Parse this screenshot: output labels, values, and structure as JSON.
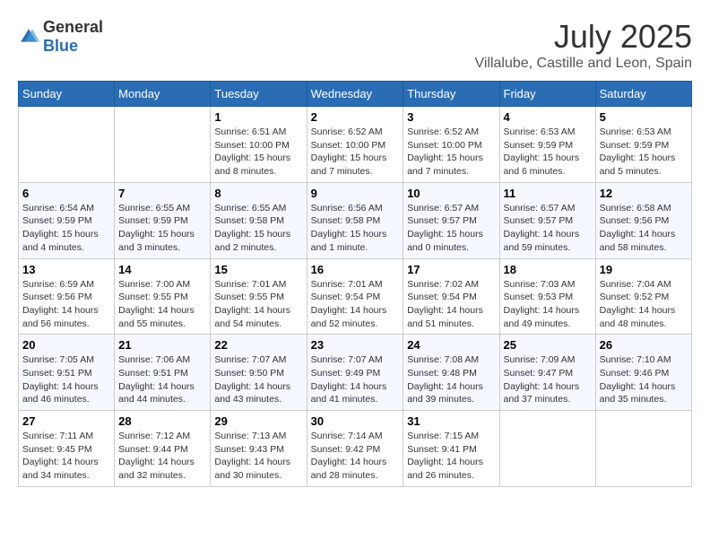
{
  "logo": {
    "general": "General",
    "blue": "Blue"
  },
  "title": "July 2025",
  "subtitle": "Villalube, Castille and Leon, Spain",
  "weekdays": [
    "Sunday",
    "Monday",
    "Tuesday",
    "Wednesday",
    "Thursday",
    "Friday",
    "Saturday"
  ],
  "weeks": [
    [
      {
        "num": "",
        "sunrise": "",
        "sunset": "",
        "daylight": ""
      },
      {
        "num": "",
        "sunrise": "",
        "sunset": "",
        "daylight": ""
      },
      {
        "num": "1",
        "sunrise": "Sunrise: 6:51 AM",
        "sunset": "Sunset: 10:00 PM",
        "daylight": "Daylight: 15 hours and 8 minutes."
      },
      {
        "num": "2",
        "sunrise": "Sunrise: 6:52 AM",
        "sunset": "Sunset: 10:00 PM",
        "daylight": "Daylight: 15 hours and 7 minutes."
      },
      {
        "num": "3",
        "sunrise": "Sunrise: 6:52 AM",
        "sunset": "Sunset: 10:00 PM",
        "daylight": "Daylight: 15 hours and 7 minutes."
      },
      {
        "num": "4",
        "sunrise": "Sunrise: 6:53 AM",
        "sunset": "Sunset: 9:59 PM",
        "daylight": "Daylight: 15 hours and 6 minutes."
      },
      {
        "num": "5",
        "sunrise": "Sunrise: 6:53 AM",
        "sunset": "Sunset: 9:59 PM",
        "daylight": "Daylight: 15 hours and 5 minutes."
      }
    ],
    [
      {
        "num": "6",
        "sunrise": "Sunrise: 6:54 AM",
        "sunset": "Sunset: 9:59 PM",
        "daylight": "Daylight: 15 hours and 4 minutes."
      },
      {
        "num": "7",
        "sunrise": "Sunrise: 6:55 AM",
        "sunset": "Sunset: 9:59 PM",
        "daylight": "Daylight: 15 hours and 3 minutes."
      },
      {
        "num": "8",
        "sunrise": "Sunrise: 6:55 AM",
        "sunset": "Sunset: 9:58 PM",
        "daylight": "Daylight: 15 hours and 2 minutes."
      },
      {
        "num": "9",
        "sunrise": "Sunrise: 6:56 AM",
        "sunset": "Sunset: 9:58 PM",
        "daylight": "Daylight: 15 hours and 1 minute."
      },
      {
        "num": "10",
        "sunrise": "Sunrise: 6:57 AM",
        "sunset": "Sunset: 9:57 PM",
        "daylight": "Daylight: 15 hours and 0 minutes."
      },
      {
        "num": "11",
        "sunrise": "Sunrise: 6:57 AM",
        "sunset": "Sunset: 9:57 PM",
        "daylight": "Daylight: 14 hours and 59 minutes."
      },
      {
        "num": "12",
        "sunrise": "Sunrise: 6:58 AM",
        "sunset": "Sunset: 9:56 PM",
        "daylight": "Daylight: 14 hours and 58 minutes."
      }
    ],
    [
      {
        "num": "13",
        "sunrise": "Sunrise: 6:59 AM",
        "sunset": "Sunset: 9:56 PM",
        "daylight": "Daylight: 14 hours and 56 minutes."
      },
      {
        "num": "14",
        "sunrise": "Sunrise: 7:00 AM",
        "sunset": "Sunset: 9:55 PM",
        "daylight": "Daylight: 14 hours and 55 minutes."
      },
      {
        "num": "15",
        "sunrise": "Sunrise: 7:01 AM",
        "sunset": "Sunset: 9:55 PM",
        "daylight": "Daylight: 14 hours and 54 minutes."
      },
      {
        "num": "16",
        "sunrise": "Sunrise: 7:01 AM",
        "sunset": "Sunset: 9:54 PM",
        "daylight": "Daylight: 14 hours and 52 minutes."
      },
      {
        "num": "17",
        "sunrise": "Sunrise: 7:02 AM",
        "sunset": "Sunset: 9:54 PM",
        "daylight": "Daylight: 14 hours and 51 minutes."
      },
      {
        "num": "18",
        "sunrise": "Sunrise: 7:03 AM",
        "sunset": "Sunset: 9:53 PM",
        "daylight": "Daylight: 14 hours and 49 minutes."
      },
      {
        "num": "19",
        "sunrise": "Sunrise: 7:04 AM",
        "sunset": "Sunset: 9:52 PM",
        "daylight": "Daylight: 14 hours and 48 minutes."
      }
    ],
    [
      {
        "num": "20",
        "sunrise": "Sunrise: 7:05 AM",
        "sunset": "Sunset: 9:51 PM",
        "daylight": "Daylight: 14 hours and 46 minutes."
      },
      {
        "num": "21",
        "sunrise": "Sunrise: 7:06 AM",
        "sunset": "Sunset: 9:51 PM",
        "daylight": "Daylight: 14 hours and 44 minutes."
      },
      {
        "num": "22",
        "sunrise": "Sunrise: 7:07 AM",
        "sunset": "Sunset: 9:50 PM",
        "daylight": "Daylight: 14 hours and 43 minutes."
      },
      {
        "num": "23",
        "sunrise": "Sunrise: 7:07 AM",
        "sunset": "Sunset: 9:49 PM",
        "daylight": "Daylight: 14 hours and 41 minutes."
      },
      {
        "num": "24",
        "sunrise": "Sunrise: 7:08 AM",
        "sunset": "Sunset: 9:48 PM",
        "daylight": "Daylight: 14 hours and 39 minutes."
      },
      {
        "num": "25",
        "sunrise": "Sunrise: 7:09 AM",
        "sunset": "Sunset: 9:47 PM",
        "daylight": "Daylight: 14 hours and 37 minutes."
      },
      {
        "num": "26",
        "sunrise": "Sunrise: 7:10 AM",
        "sunset": "Sunset: 9:46 PM",
        "daylight": "Daylight: 14 hours and 35 minutes."
      }
    ],
    [
      {
        "num": "27",
        "sunrise": "Sunrise: 7:11 AM",
        "sunset": "Sunset: 9:45 PM",
        "daylight": "Daylight: 14 hours and 34 minutes."
      },
      {
        "num": "28",
        "sunrise": "Sunrise: 7:12 AM",
        "sunset": "Sunset: 9:44 PM",
        "daylight": "Daylight: 14 hours and 32 minutes."
      },
      {
        "num": "29",
        "sunrise": "Sunrise: 7:13 AM",
        "sunset": "Sunset: 9:43 PM",
        "daylight": "Daylight: 14 hours and 30 minutes."
      },
      {
        "num": "30",
        "sunrise": "Sunrise: 7:14 AM",
        "sunset": "Sunset: 9:42 PM",
        "daylight": "Daylight: 14 hours and 28 minutes."
      },
      {
        "num": "31",
        "sunrise": "Sunrise: 7:15 AM",
        "sunset": "Sunset: 9:41 PM",
        "daylight": "Daylight: 14 hours and 26 minutes."
      },
      {
        "num": "",
        "sunrise": "",
        "sunset": "",
        "daylight": ""
      },
      {
        "num": "",
        "sunrise": "",
        "sunset": "",
        "daylight": ""
      }
    ]
  ]
}
